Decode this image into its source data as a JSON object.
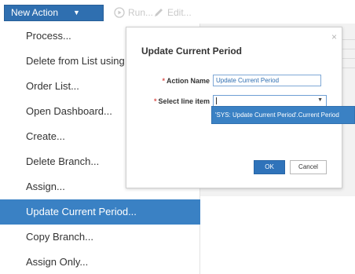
{
  "toolbar": {
    "new_action_label": "New Action",
    "run_label": "Run...",
    "edit_label": "Edit..."
  },
  "menu": {
    "items": [
      {
        "label": "Process..."
      },
      {
        "label": "Delete from List using Selection..."
      },
      {
        "label": "Order List..."
      },
      {
        "label": "Open Dashboard..."
      },
      {
        "label": "Create..."
      },
      {
        "label": "Delete Branch..."
      },
      {
        "label": "Assign..."
      },
      {
        "label": "Update Current Period..."
      },
      {
        "label": "Copy Branch..."
      },
      {
        "label": "Assign Only..."
      }
    ],
    "active_index": 7
  },
  "modal": {
    "title": "Update Current Period",
    "close_glyph": "×",
    "action_name_label": "Action Name",
    "action_name_value": "Update Current Period",
    "select_line_item_label": "Select line item",
    "select_line_item_value": "",
    "ok_label": "OK",
    "cancel_label": "Cancel"
  },
  "dropdown": {
    "options": [
      "'SYS: Update Current Period'.Current Period"
    ]
  },
  "colors": {
    "accent": "#2f6fb0",
    "active_menu": "#3a81c4",
    "required": "#d9534f"
  }
}
